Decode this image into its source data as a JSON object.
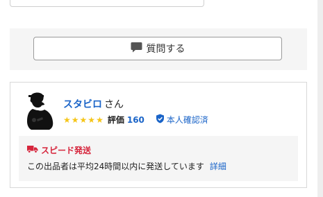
{
  "question": {
    "button_label": "質問する"
  },
  "seller": {
    "name": "スタビロ",
    "suffix": "さん",
    "rating_label": "評価",
    "rating_count": "160",
    "stars": 5,
    "verified_label": "本人確認済"
  },
  "shipping": {
    "title": "スピード発送",
    "description": "この出品者は平均24時間以内に発送しています",
    "detail_link": "詳細"
  },
  "colors": {
    "link": "#1a64c8",
    "star": "#f5c518",
    "shipping_accent": "#d6253c",
    "panel_bg": "#f5f5f5"
  },
  "icons": {
    "question": "speech-bubble-icon",
    "verified": "shield-check-icon",
    "shipping": "truck-icon",
    "avatar": "silhouette-avatar"
  }
}
